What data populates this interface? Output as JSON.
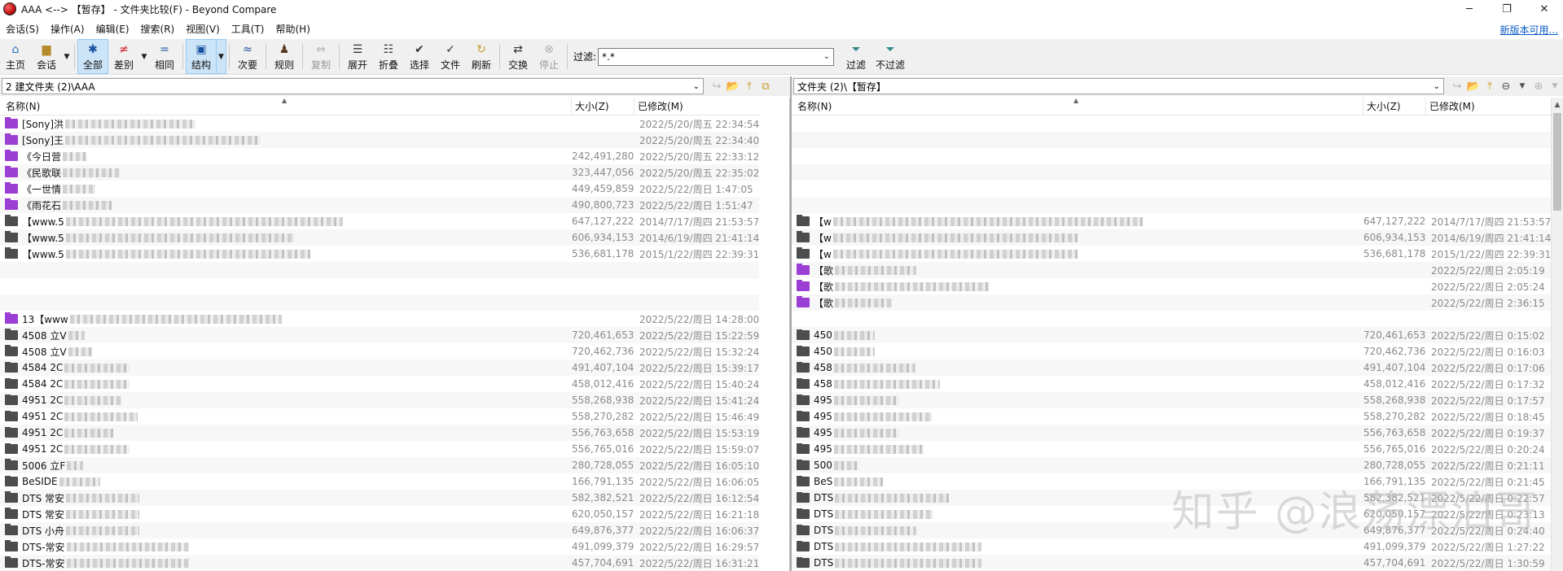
{
  "window": {
    "title": "AAA <--> 【暂存】 - 文件夹比较(F) - Beyond Compare",
    "minimize": "─",
    "restore": "❐",
    "close": "✕"
  },
  "menu": {
    "items": [
      "会话(S)",
      "操作(A)",
      "编辑(E)",
      "搜索(R)",
      "视图(V)",
      "工具(T)",
      "帮助(H)"
    ],
    "new_version": "新版本可用..."
  },
  "toolbar": {
    "home": "主页",
    "session": "会话",
    "all": "全部",
    "diff": "差别",
    "same": "相同",
    "structure": "结构",
    "minor": "次要",
    "rules": "规则",
    "copy": "复制",
    "expand": "展开",
    "collapse": "折叠",
    "select": "选择",
    "files": "文件",
    "refresh": "刷新",
    "swap": "交换",
    "stop": "停止",
    "filter_label": "过滤:",
    "filter_value": "*.*",
    "filter": "过滤",
    "no_filter": "不过滤"
  },
  "left_path": "2 建文件夹 (2)\\AAA",
  "right_path": "文件夹 (2)\\【暂存】",
  "columns": {
    "name": "名称(N)",
    "size": "大小(Z)",
    "modified": "已修改(M)"
  },
  "left_rows": [
    {
      "name": "[Sony]洪",
      "size": "",
      "date": "2022/5/20/周五 22:34:54",
      "color": "purple",
      "blur": 160
    },
    {
      "name": "[Sony]王",
      "size": "",
      "date": "2022/5/20/周五 22:34:40",
      "color": "purple",
      "blur": 240
    },
    {
      "name": "《今日营",
      "size": "242,491,280",
      "date": "2022/5/20/周五 22:33:12",
      "color": "purple",
      "blur": 30
    },
    {
      "name": "《民歌联",
      "size": "323,447,056",
      "date": "2022/5/20/周五 22:35:02",
      "color": "purple",
      "blur": 70
    },
    {
      "name": "《一世情",
      "size": "449,459,859",
      "date": "2022/5/22/周日 1:47:05",
      "color": "purple",
      "blur": 40
    },
    {
      "name": "《雨花石",
      "size": "490,800,723",
      "date": "2022/5/22/周日 1:51:47",
      "color": "purple",
      "blur": 60
    },
    {
      "name": "【www.5",
      "size": "647,127,222",
      "date": "2014/7/17/周四 21:53:57",
      "color": "gray",
      "blur": 340
    },
    {
      "name": "【www.5",
      "size": "606,934,153",
      "date": "2014/6/19/周四 21:41:14",
      "color": "gray",
      "blur": 280
    },
    {
      "name": "【www.5",
      "size": "536,681,178",
      "date": "2015/1/22/周四 22:39:31",
      "color": "gray",
      "blur": 300
    },
    {
      "name": "",
      "size": "",
      "date": "",
      "color": "",
      "blur": 0
    },
    {
      "name": "",
      "size": "",
      "date": "",
      "color": "",
      "blur": 0
    },
    {
      "name": "",
      "size": "",
      "date": "",
      "color": "",
      "blur": 0
    },
    {
      "name": "13【www",
      "size": "",
      "date": "2022/5/22/周日 14:28:00",
      "color": "purple",
      "blur": 260
    },
    {
      "name": "4508 立V",
      "size": "720,461,653",
      "date": "2022/5/22/周日 15:22:59",
      "color": "gray",
      "blur": 20
    },
    {
      "name": "4508 立V",
      "size": "720,462,736",
      "date": "2022/5/22/周日 15:32:24",
      "color": "gray",
      "blur": 30
    },
    {
      "name": "4584 2C",
      "size": "491,407,104",
      "date": "2022/5/22/周日 15:39:17",
      "color": "gray",
      "blur": 80
    },
    {
      "name": "4584 2C",
      "size": "458,012,416",
      "date": "2022/5/22/周日 15:40:24",
      "color": "gray",
      "blur": 80
    },
    {
      "name": "4951 2C",
      "size": "558,268,938",
      "date": "2022/5/22/周日 15:41:24",
      "color": "gray",
      "blur": 70
    },
    {
      "name": "4951 2C",
      "size": "558,270,282",
      "date": "2022/5/22/周日 15:46:49",
      "color": "gray",
      "blur": 90
    },
    {
      "name": "4951 2C",
      "size": "556,763,658",
      "date": "2022/5/22/周日 15:53:19",
      "color": "gray",
      "blur": 60
    },
    {
      "name": "4951 2C",
      "size": "556,765,016",
      "date": "2022/5/22/周日 15:59:07",
      "color": "gray",
      "blur": 80
    },
    {
      "name": "5006 立F",
      "size": "280,728,055",
      "date": "2022/5/22/周日 16:05:10",
      "color": "gray",
      "blur": 20
    },
    {
      "name": "BeSIDE",
      "size": "166,791,135",
      "date": "2022/5/22/周日 16:06:05",
      "color": "gray",
      "blur": 50
    },
    {
      "name": "DTS 常安",
      "size": "582,382,521",
      "date": "2022/5/22/周日 16:12:54",
      "color": "gray",
      "blur": 90
    },
    {
      "name": "DTS 常安",
      "size": "620,050,157",
      "date": "2022/5/22/周日 16:21:18",
      "color": "gray",
      "blur": 90
    },
    {
      "name": "DTS 小舟",
      "size": "649,876,377",
      "date": "2022/5/22/周日 16:06:37",
      "color": "gray",
      "blur": 90
    },
    {
      "name": "DTS-常安",
      "size": "491,099,379",
      "date": "2022/5/22/周日 16:29:57",
      "color": "gray",
      "blur": 150
    },
    {
      "name": "DTS-常安",
      "size": "457,704,691",
      "date": "2022/5/22/周日 16:31:21",
      "color": "gray",
      "blur": 150
    }
  ],
  "right_rows": [
    {
      "name": "",
      "size": "",
      "date": "",
      "color": "",
      "blur": 0
    },
    {
      "name": "",
      "size": "",
      "date": "",
      "color": "",
      "blur": 0
    },
    {
      "name": "",
      "size": "",
      "date": "",
      "color": "",
      "blur": 0
    },
    {
      "name": "",
      "size": "",
      "date": "",
      "color": "",
      "blur": 0
    },
    {
      "name": "",
      "size": "",
      "date": "",
      "color": "",
      "blur": 0
    },
    {
      "name": "",
      "size": "",
      "date": "",
      "color": "",
      "blur": 0
    },
    {
      "name": "【w",
      "size": "647,127,222",
      "date": "2014/7/17/周四 21:53:57",
      "color": "gray",
      "blur": 380
    },
    {
      "name": "【w",
      "size": "606,934,153",
      "date": "2014/6/19/周四 21:41:14",
      "color": "gray",
      "blur": 300
    },
    {
      "name": "【w",
      "size": "536,681,178",
      "date": "2015/1/22/周四 22:39:31",
      "color": "gray",
      "blur": 300
    },
    {
      "name": "【歌",
      "size": "",
      "date": "2022/5/22/周日 2:05:19",
      "color": "purple",
      "blur": 100
    },
    {
      "name": "【歌",
      "size": "",
      "date": "2022/5/22/周日 2:05:24",
      "color": "purple",
      "blur": 190
    },
    {
      "name": "【歌",
      "size": "",
      "date": "2022/5/22/周日 2:36:15",
      "color": "purple",
      "blur": 70
    },
    {
      "name": "",
      "size": "",
      "date": "",
      "color": "",
      "blur": 0
    },
    {
      "name": "450",
      "size": "720,461,653",
      "date": "2022/5/22/周日 0:15:02",
      "color": "gray",
      "blur": 50
    },
    {
      "name": "450",
      "size": "720,462,736",
      "date": "2022/5/22/周日 0:16:03",
      "color": "gray",
      "blur": 50
    },
    {
      "name": "458",
      "size": "491,407,104",
      "date": "2022/5/22/周日 0:17:06",
      "color": "gray",
      "blur": 100
    },
    {
      "name": "458",
      "size": "458,012,416",
      "date": "2022/5/22/周日 0:17:32",
      "color": "gray",
      "blur": 130
    },
    {
      "name": "495",
      "size": "558,268,938",
      "date": "2022/5/22/周日 0:17:57",
      "color": "gray",
      "blur": 80
    },
    {
      "name": "495",
      "size": "558,270,282",
      "date": "2022/5/22/周日 0:18:45",
      "color": "gray",
      "blur": 120
    },
    {
      "name": "495",
      "size": "556,763,658",
      "date": "2022/5/22/周日 0:19:37",
      "color": "gray",
      "blur": 80
    },
    {
      "name": "495",
      "size": "556,765,016",
      "date": "2022/5/22/周日 0:20:24",
      "color": "gray",
      "blur": 110
    },
    {
      "name": "500",
      "size": "280,728,055",
      "date": "2022/5/22/周日 0:21:11",
      "color": "gray",
      "blur": 30
    },
    {
      "name": "BeS",
      "size": "166,791,135",
      "date": "2022/5/22/周日 0:21:45",
      "color": "gray",
      "blur": 60
    },
    {
      "name": "DTS",
      "size": "582,382,521",
      "date": "2022/5/22/周日 0:22:57",
      "color": "gray",
      "blur": 140
    },
    {
      "name": "DTS",
      "size": "620,050,157",
      "date": "2022/5/22/周日 0:23:13",
      "color": "gray",
      "blur": 120
    },
    {
      "name": "DTS",
      "size": "649,876,377",
      "date": "2022/5/22/周日 0:24:40",
      "color": "gray",
      "blur": 100
    },
    {
      "name": "DTS",
      "size": "491,099,379",
      "date": "2022/5/22/周日 1:27:22",
      "color": "gray",
      "blur": 180
    },
    {
      "name": "DTS",
      "size": "457,704,691",
      "date": "2022/5/22/周日 1:30:59",
      "color": "gray",
      "blur": 180
    }
  ],
  "watermark": "知乎 @浪荡漂泊哥",
  "colors": {
    "active_button": "#cce4f7",
    "folder_purple": "#9b3fd4",
    "folder_gray": "#4d4d4d",
    "link": "#0a5bc4"
  }
}
